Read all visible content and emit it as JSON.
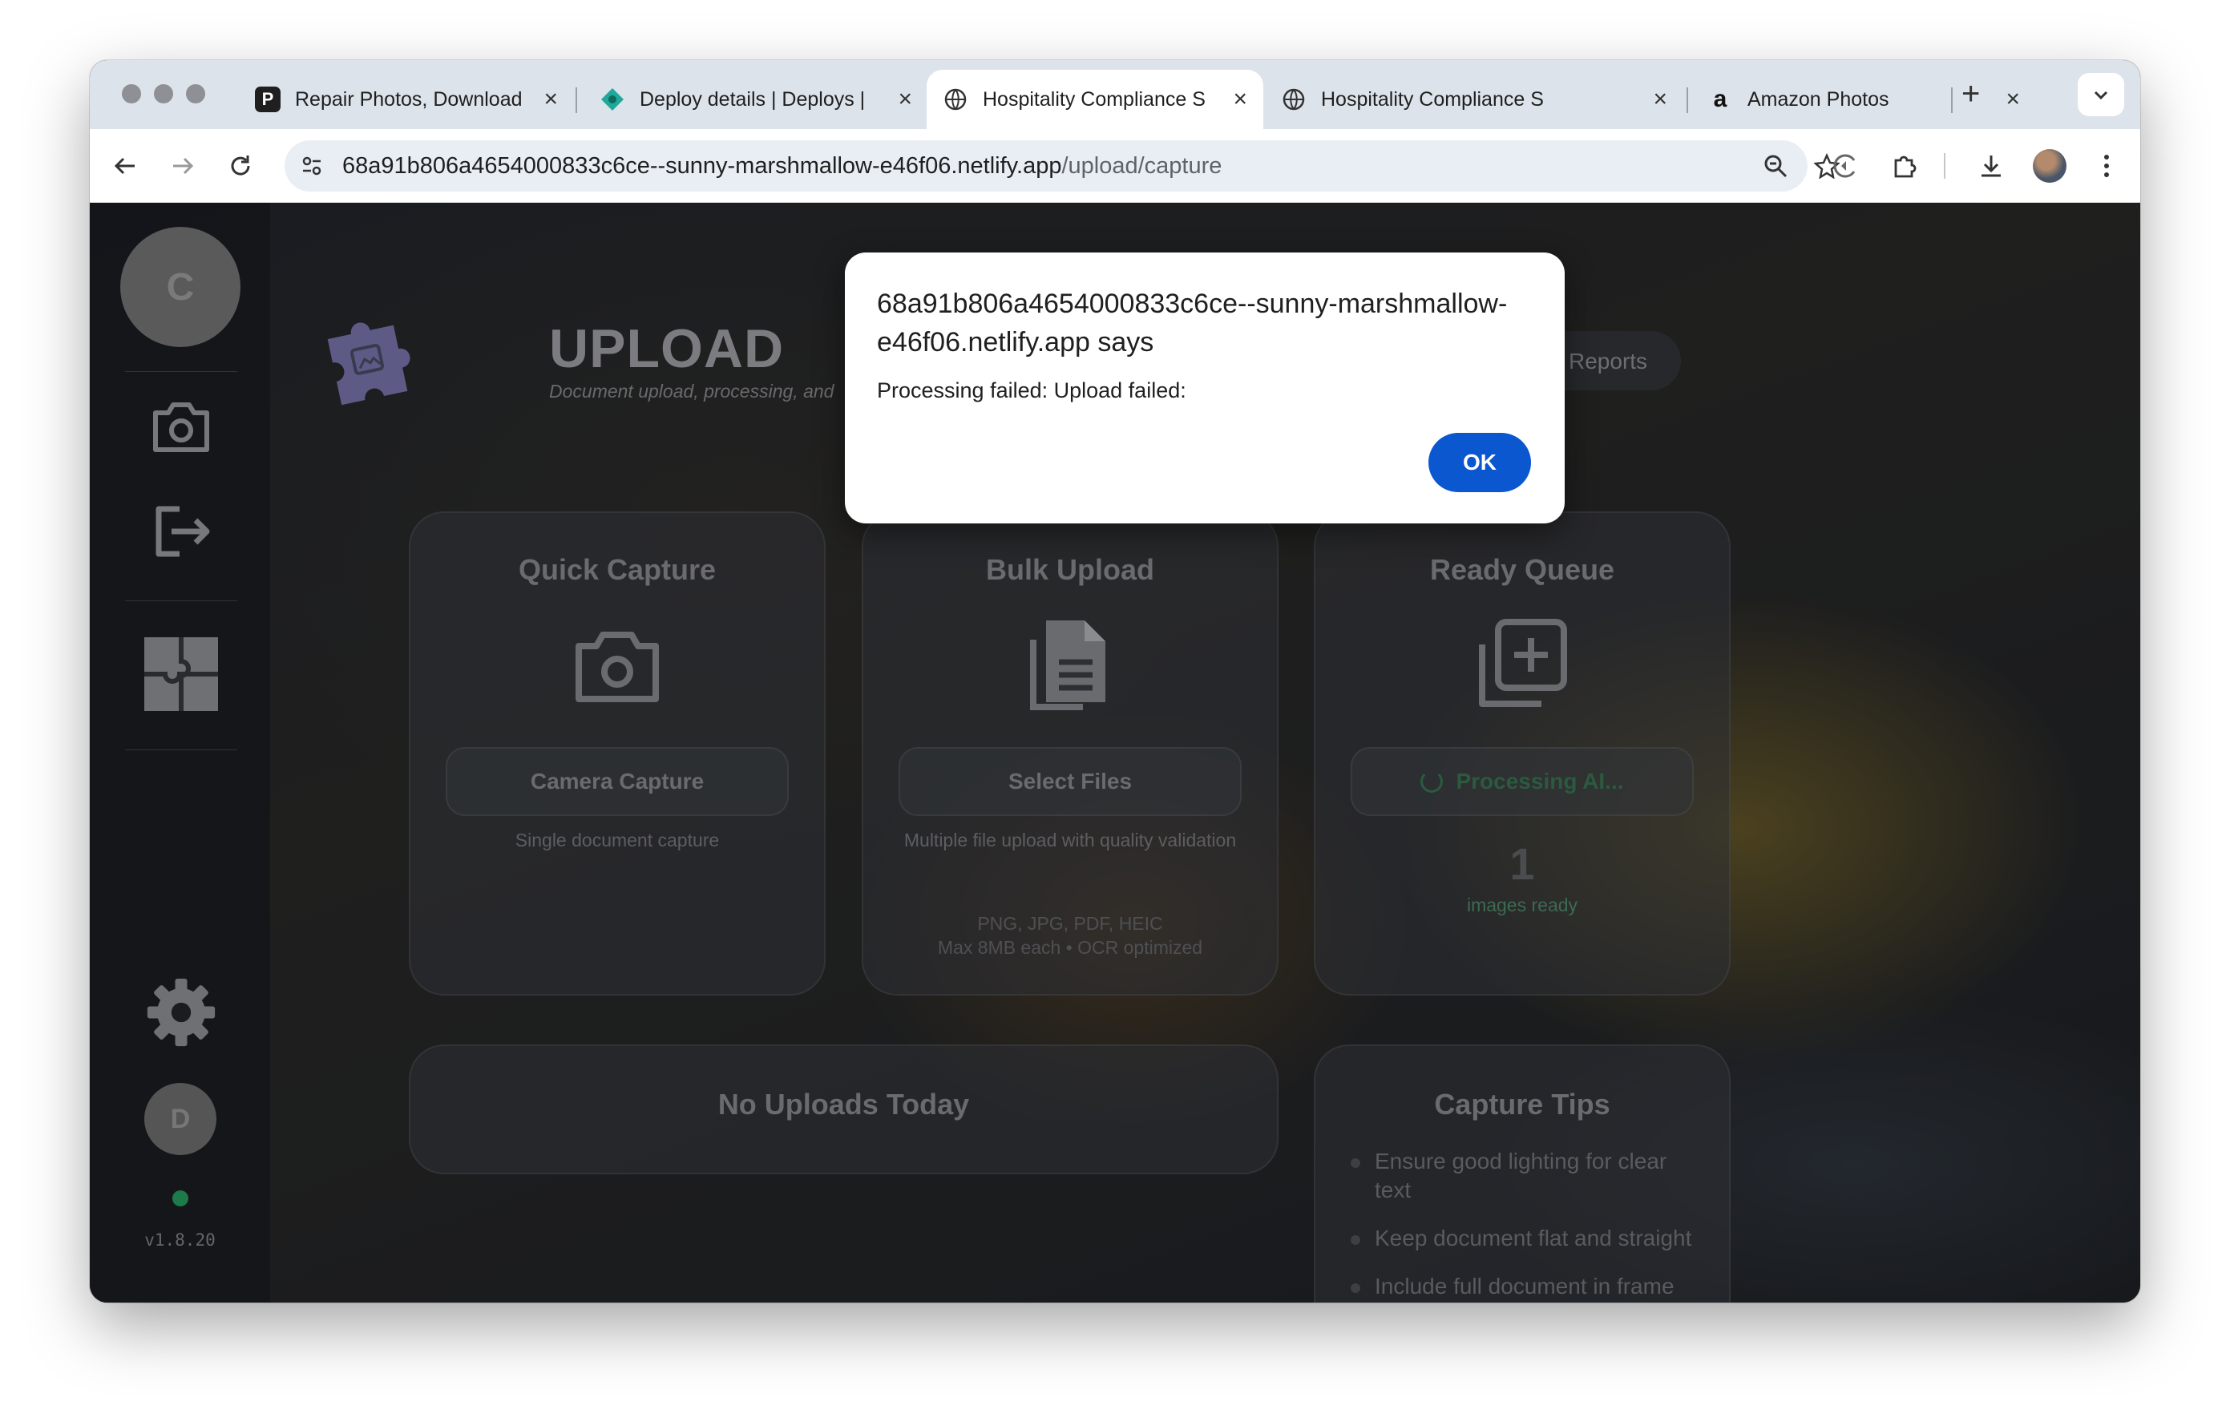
{
  "browser": {
    "tabs": [
      {
        "title": "Repair Photos, Download",
        "favicon": "photoroom-icon",
        "active": false
      },
      {
        "title": "Deploy details | Deploys |",
        "favicon": "netlify-icon",
        "active": false
      },
      {
        "title": "Hospitality Compliance S",
        "favicon": "globe-icon",
        "active": true
      },
      {
        "title": "Hospitality Compliance S",
        "favicon": "globe-icon",
        "active": false
      },
      {
        "title": "Amazon Photos",
        "favicon": "amazon-icon",
        "active": false
      }
    ],
    "url_host": "68a91b806a4654000833c6ce--sunny-marshmallow-e46f06.netlify.app",
    "url_path": "/upload/capture",
    "amazon_letter": "a",
    "photoroom_letter": "P"
  },
  "sidebar": {
    "avatar_letter": "C",
    "user_letter": "D",
    "version": "v1.8.20",
    "status_color": "#1d7a4a"
  },
  "header": {
    "title": "UPLOAD",
    "subtitle": "Document upload, processing, and",
    "nav_label": "Reports"
  },
  "cards": {
    "quick_capture": {
      "title": "Quick Capture",
      "button": "Camera Capture",
      "desc": "Single document capture"
    },
    "bulk_upload": {
      "title": "Bulk Upload",
      "button": "Select Files",
      "desc": "Multiple file upload with quality validation",
      "formats": "PNG, JPG, PDF, HEIC",
      "limits": "Max 8MB each • OCR optimized"
    },
    "ready_queue": {
      "title": "Ready Queue",
      "button": "Processing AI...",
      "count": "1",
      "count_label": "images ready"
    },
    "uploads_today": {
      "title": "No Uploads Today"
    },
    "capture_tips": {
      "title": "Capture Tips",
      "tips": [
        "Ensure good lighting for clear text",
        "Keep document flat and straight",
        "Include full document in frame"
      ]
    }
  },
  "dialog": {
    "title": "68a91b806a4654000833c6ce--sunny-marshmallow-e46f06.netlify.app says",
    "message": "Processing failed: Upload failed:",
    "ok_label": "OK",
    "ok_color": "#0b57d0"
  }
}
